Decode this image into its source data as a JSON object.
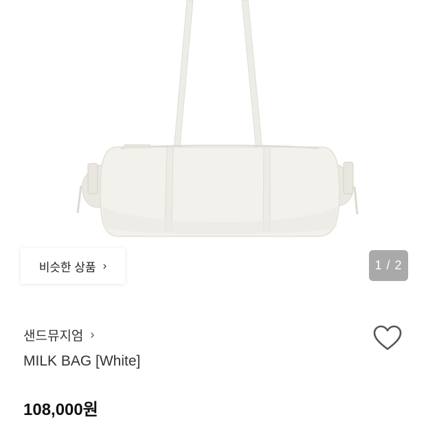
{
  "hero": {
    "image_alt": "white shoulder bag product photo"
  },
  "similar": {
    "label": "비슷한 상품",
    "chevron": "›"
  },
  "pager": {
    "text": "1 / 2"
  },
  "product": {
    "brand": "샌드뮤지엄",
    "brand_chevron": "›",
    "name": "MILK BAG [White]",
    "price": "108,000원"
  },
  "icons": {
    "favorite": "heart-outline-icon"
  },
  "colors": {
    "bag": "#f3f1ec",
    "pager_bg": "#a9a9a9",
    "text": "#222222"
  }
}
